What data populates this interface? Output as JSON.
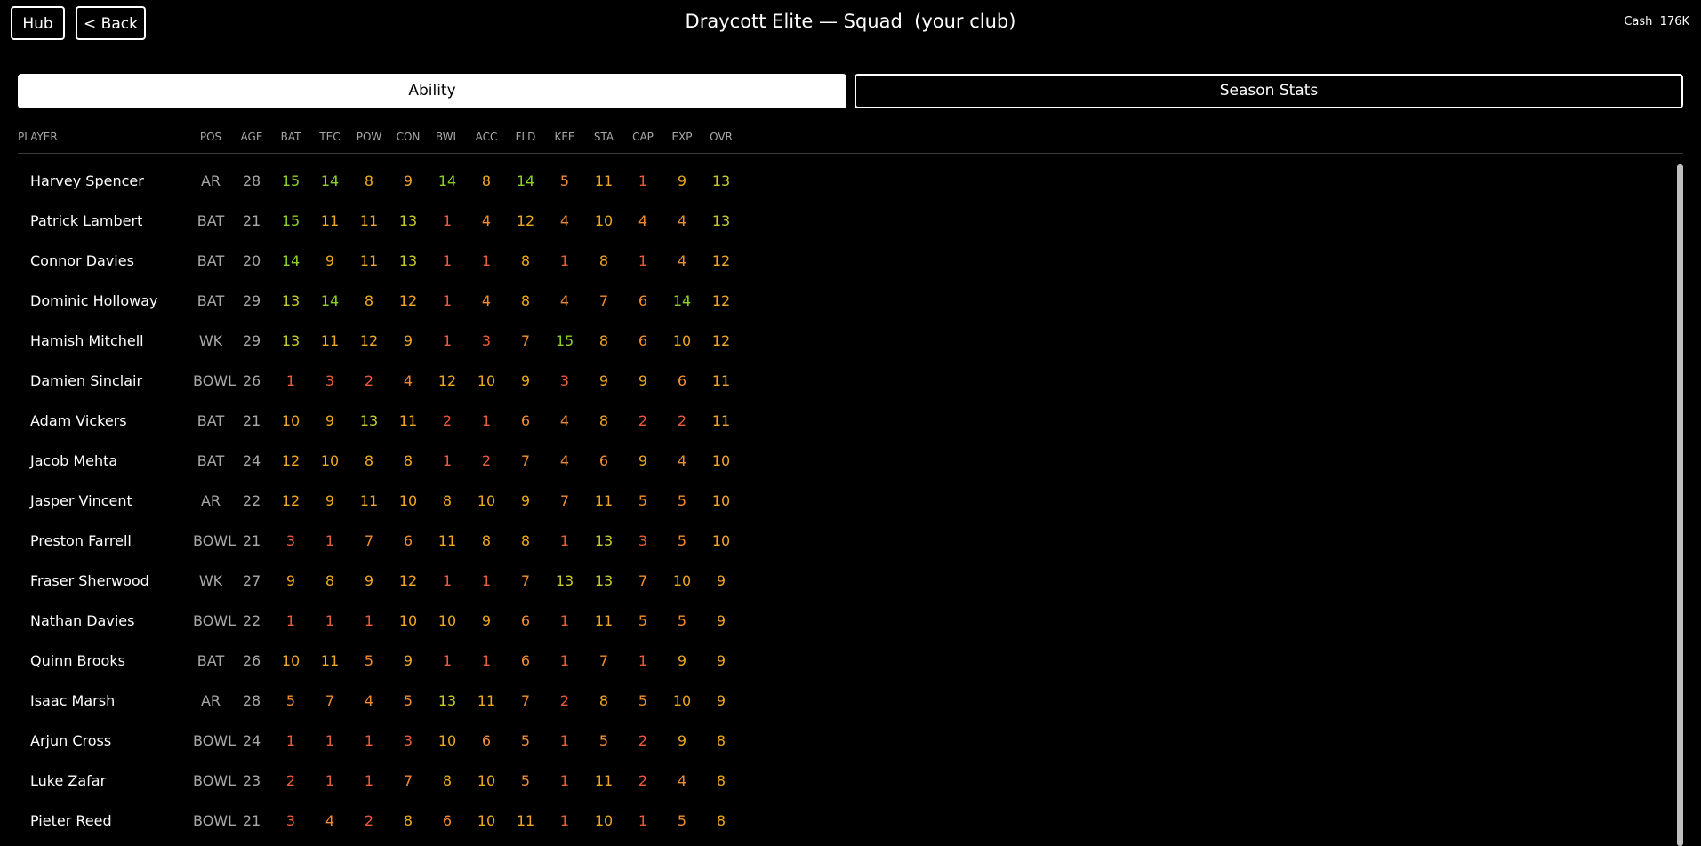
{
  "header": {
    "hub_label": "Hub",
    "back_label": "< Back",
    "title": "Draycott Elite — Squad  (your club)",
    "cash_text": "Cash  176K"
  },
  "tabs": [
    {
      "label": "Ability",
      "active": true
    },
    {
      "label": "Season Stats",
      "active": false
    }
  ],
  "columns": [
    "PLAYER",
    "POS",
    "AGE",
    "BAT",
    "TEC",
    "POW",
    "CON",
    "BWL",
    "ACC",
    "FLD",
    "KEE",
    "STA",
    "CAP",
    "EXP",
    "OVR"
  ],
  "rating_colors": {
    "low": "#ee5b38",
    "mid_low": "#f28c30",
    "mid": "#f0a81c",
    "high": "#c8cc22",
    "top": "#8fd11f"
  },
  "players": [
    {
      "name": "Harvey Spencer",
      "pos": "AR",
      "age": "28",
      "stats": [
        "15",
        "14",
        "8",
        "9",
        "14",
        "8",
        "14",
        "5",
        "11",
        "1",
        "9",
        "13"
      ]
    },
    {
      "name": "Patrick Lambert",
      "pos": "BAT",
      "age": "21",
      "stats": [
        "15",
        "11",
        "11",
        "13",
        "1",
        "4",
        "12",
        "4",
        "10",
        "4",
        "4",
        "13"
      ]
    },
    {
      "name": "Connor Davies",
      "pos": "BAT",
      "age": "20",
      "stats": [
        "14",
        "9",
        "11",
        "13",
        "1",
        "1",
        "8",
        "1",
        "8",
        "1",
        "4",
        "12"
      ]
    },
    {
      "name": "Dominic Holloway",
      "pos": "BAT",
      "age": "29",
      "stats": [
        "13",
        "14",
        "8",
        "12",
        "1",
        "4",
        "8",
        "4",
        "7",
        "6",
        "14",
        "12"
      ]
    },
    {
      "name": "Hamish Mitchell",
      "pos": "WK",
      "age": "29",
      "stats": [
        "13",
        "11",
        "12",
        "9",
        "1",
        "3",
        "7",
        "15",
        "8",
        "6",
        "10",
        "12"
      ]
    },
    {
      "name": "Damien Sinclair",
      "pos": "BOWL",
      "age": "26",
      "stats": [
        "1",
        "3",
        "2",
        "4",
        "12",
        "10",
        "9",
        "3",
        "9",
        "9",
        "6",
        "11"
      ]
    },
    {
      "name": "Adam Vickers",
      "pos": "BAT",
      "age": "21",
      "stats": [
        "10",
        "9",
        "13",
        "11",
        "2",
        "1",
        "6",
        "4",
        "8",
        "2",
        "2",
        "11"
      ]
    },
    {
      "name": "Jacob Mehta",
      "pos": "BAT",
      "age": "24",
      "stats": [
        "12",
        "10",
        "8",
        "8",
        "1",
        "2",
        "7",
        "4",
        "6",
        "9",
        "4",
        "10"
      ]
    },
    {
      "name": "Jasper Vincent",
      "pos": "AR",
      "age": "22",
      "stats": [
        "12",
        "9",
        "11",
        "10",
        "8",
        "10",
        "9",
        "7",
        "11",
        "5",
        "5",
        "10"
      ]
    },
    {
      "name": "Preston Farrell",
      "pos": "BOWL",
      "age": "21",
      "stats": [
        "3",
        "1",
        "7",
        "6",
        "11",
        "8",
        "8",
        "1",
        "13",
        "3",
        "5",
        "10"
      ]
    },
    {
      "name": "Fraser Sherwood",
      "pos": "WK",
      "age": "27",
      "stats": [
        "9",
        "8",
        "9",
        "12",
        "1",
        "1",
        "7",
        "13",
        "13",
        "7",
        "10",
        "9"
      ]
    },
    {
      "name": "Nathan Davies",
      "pos": "BOWL",
      "age": "22",
      "stats": [
        "1",
        "1",
        "1",
        "10",
        "10",
        "9",
        "6",
        "1",
        "11",
        "5",
        "5",
        "9"
      ]
    },
    {
      "name": "Quinn Brooks",
      "pos": "BAT",
      "age": "26",
      "stats": [
        "10",
        "11",
        "5",
        "9",
        "1",
        "1",
        "6",
        "1",
        "7",
        "1",
        "9",
        "9"
      ]
    },
    {
      "name": "Isaac Marsh",
      "pos": "AR",
      "age": "28",
      "stats": [
        "5",
        "7",
        "4",
        "5",
        "13",
        "11",
        "7",
        "2",
        "8",
        "5",
        "10",
        "9"
      ]
    },
    {
      "name": "Arjun Cross",
      "pos": "BOWL",
      "age": "24",
      "stats": [
        "1",
        "1",
        "1",
        "3",
        "10",
        "6",
        "5",
        "1",
        "5",
        "2",
        "9",
        "8"
      ]
    },
    {
      "name": "Luke Zafar",
      "pos": "BOWL",
      "age": "23",
      "stats": [
        "2",
        "1",
        "1",
        "7",
        "8",
        "10",
        "5",
        "1",
        "11",
        "2",
        "4",
        "8"
      ]
    },
    {
      "name": "Pieter Reed",
      "pos": "BOWL",
      "age": "21",
      "stats": [
        "3",
        "4",
        "2",
        "8",
        "6",
        "10",
        "11",
        "1",
        "10",
        "1",
        "5",
        "8"
      ]
    }
  ]
}
